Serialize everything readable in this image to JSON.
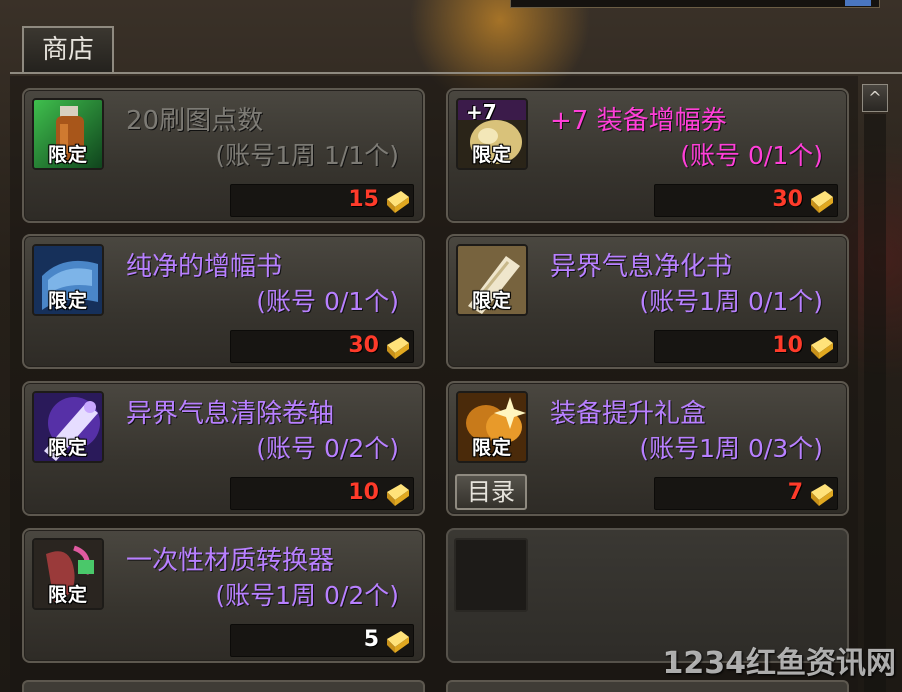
{
  "shop": {
    "tab_label": "商店",
    "scroll_up_glyph": "^",
    "catalog_label": "目录",
    "limited_label": "限定",
    "watermark": "1234红鱼资讯网",
    "items": [
      {
        "name": "20刷图点数",
        "limit": "(账号1周 1/1个)",
        "price": "15",
        "name_color": "gray",
        "icon": "potion-icon"
      },
      {
        "name": "+7 装备增幅券",
        "limit": "(账号 0/1个)",
        "price": "30",
        "name_color": "magenta",
        "icon": "amplify-ticket-icon",
        "icon_badge": "+7"
      },
      {
        "name": "纯净的增幅书",
        "limit": "(账号 0/1个)",
        "price": "30",
        "name_color": "purple",
        "icon": "blue-book-icon"
      },
      {
        "name": "异界气息净化书",
        "limit": "(账号1周 0/1个)",
        "price": "10",
        "name_color": "purple",
        "icon": "purify-book-icon"
      },
      {
        "name": "异界气息清除卷轴",
        "limit": "(账号 0/2个)",
        "price": "10",
        "name_color": "purple",
        "icon": "scroll-icon"
      },
      {
        "name": "装备提升礼盒",
        "limit": "(账号1周 0/3个)",
        "price": "7",
        "name_color": "purple",
        "icon": "gift-box-icon"
      },
      {
        "name": "一次性材质转换器",
        "limit": "(账号1周 0/2个)",
        "price": "5",
        "name_color": "purple",
        "icon": "material-converter-icon"
      }
    ]
  },
  "colors": {
    "gray_name": "#7d7b75",
    "purple_name": "#b880ff",
    "magenta_name": "#ff3fd8",
    "price_red": "#ff3b2a",
    "price_white": "#ffffff",
    "gold_coin": "#f2c230"
  }
}
